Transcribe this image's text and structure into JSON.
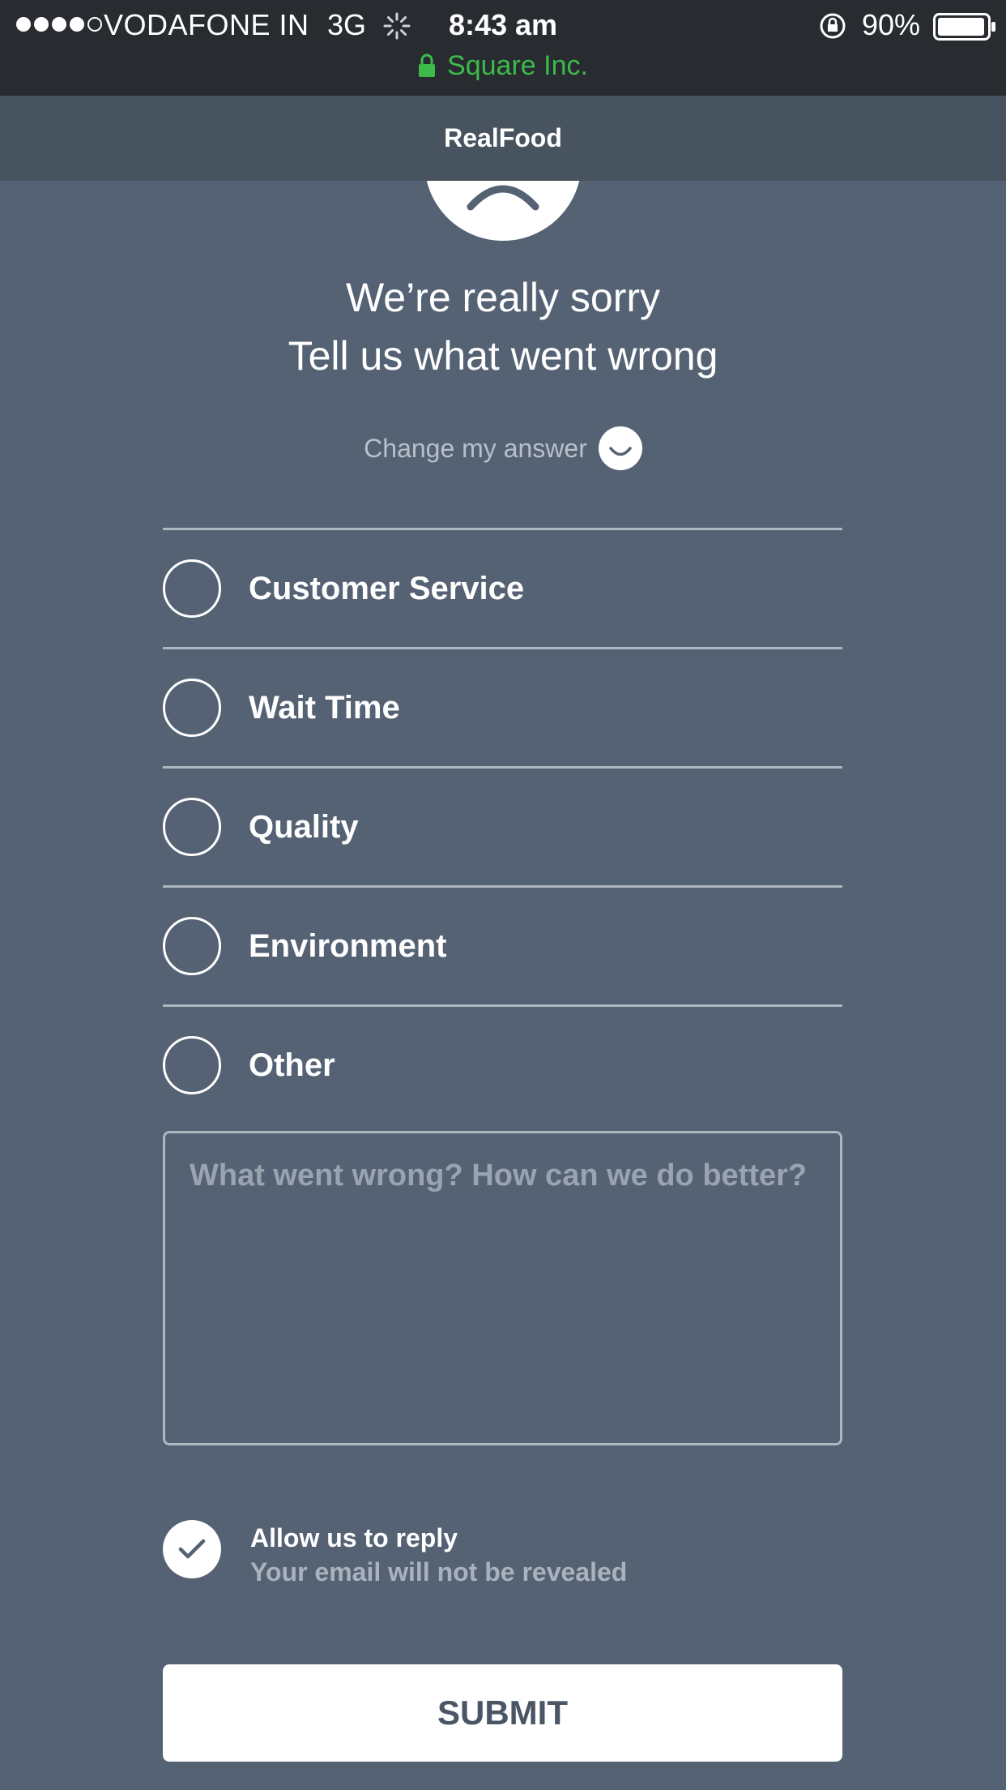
{
  "status_bar": {
    "carrier": "VODAFONE IN",
    "network": "3G",
    "time": "8:43 am",
    "battery": "90%",
    "secure_site": "Square Inc.",
    "signal_bars_filled": 4,
    "signal_bars_total": 5
  },
  "header": {
    "title": "RealFood"
  },
  "main": {
    "headline_line1": "We’re really sorry",
    "headline_line2": "Tell us what went wrong",
    "change_answer": "Change my answer",
    "options": [
      {
        "label": "Customer Service",
        "selected": false
      },
      {
        "label": "Wait Time",
        "selected": false
      },
      {
        "label": "Quality",
        "selected": false
      },
      {
        "label": "Environment",
        "selected": false
      },
      {
        "label": "Other",
        "selected": false
      }
    ],
    "feedback_placeholder": "What went wrong? How can we do better?",
    "feedback_value": "",
    "reply": {
      "title": "Allow us to reply",
      "subtitle": "Your email will not be revealed",
      "checked": true
    },
    "submit_label": "SUBMIT"
  },
  "colors": {
    "background": "#546274",
    "status_bar": "#282c31",
    "header": "#47535f",
    "secure_green": "#3cbb4a",
    "submit_text": "#4a5665"
  }
}
